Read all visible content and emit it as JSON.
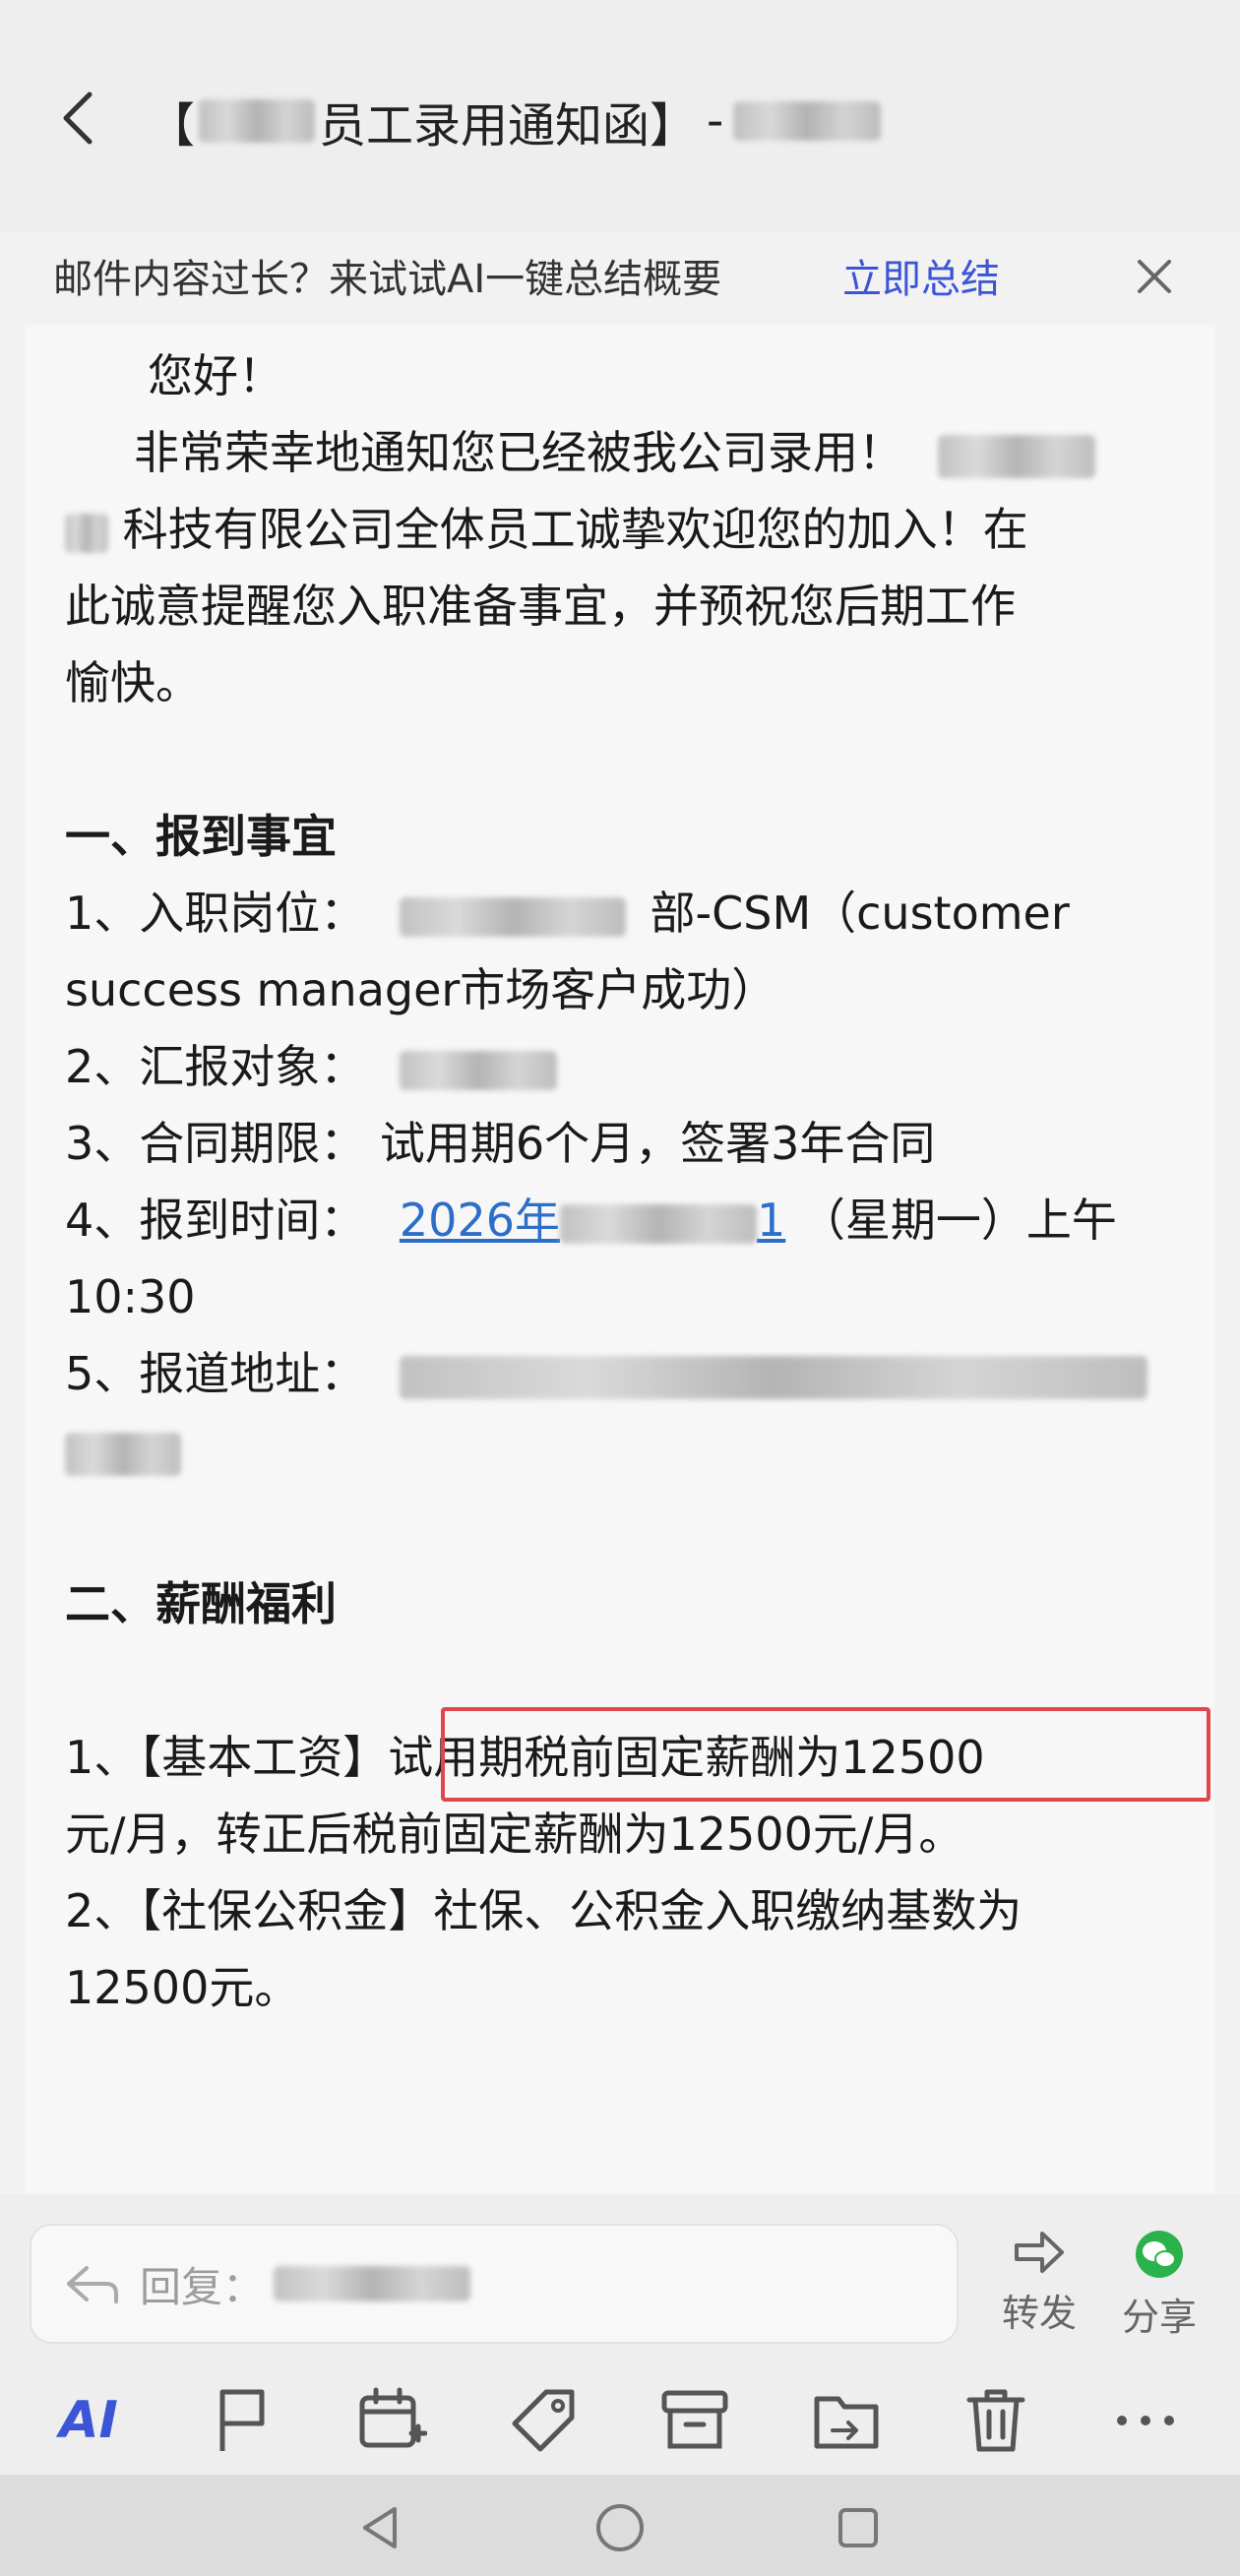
{
  "header": {
    "title_prefix": "【",
    "title_main": "员工录用通知函】",
    "title_sep": "-"
  },
  "ai_banner": {
    "message": "邮件内容过长？来试试AI一键总结概要",
    "action": "立即总结"
  },
  "body": {
    "greeting": "您好！",
    "intro_1": "非常荣幸地通知您已经被我公司录用！",
    "intro_2": "科技有限公司全体员工诚挚欢迎您的加入！在",
    "intro_3": "此诚意提醒您入职准备事宜，并预祝您后期工作",
    "intro_4": "愉快。",
    "section1_title": "一、报到事宜",
    "item1_label": "1、入职岗位：",
    "item1_value": "部-CSM（customer",
    "item1_cont": "success manager市场客户成功）",
    "item2_label": "2、汇报对象：",
    "item3": "3、合同期限：  试用期6个月，签署3年合同",
    "item4_label": "4、报到时间：",
    "item4_date_prefix": "2026年",
    "item4_date_suffix": "1",
    "item4_rest": "（星期一）上午",
    "item4_cont": "10:30",
    "item5_label": "5、报道地址：",
    "section2_title": "二、薪酬福利",
    "salary_1_a": "1、【基本工资】",
    "salary_1_b": "试用期税前固定薪酬为12500",
    "salary_1_cont": "元/月，转正后税前固定薪酬为12500元/月。",
    "salary_2": "2、【社保公积金】社保、公积金入职缴纳基数为",
    "salary_2_cont": "12500元。"
  },
  "reply": {
    "placeholder": "回复：",
    "forward": "转发",
    "share": "分享"
  },
  "toolbar": {
    "ai_label": "AI"
  },
  "colors": {
    "accent": "#3b55d6",
    "link": "#2c6fc9",
    "highlight": "#e0474a",
    "wechat": "#2bb24c"
  }
}
